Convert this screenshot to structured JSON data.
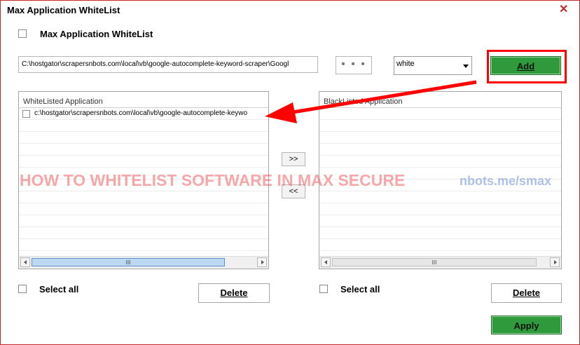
{
  "window": {
    "title": "Max Application WhiteList"
  },
  "top_option": {
    "label": "Max Application WhiteList"
  },
  "path_input": {
    "value": "C:\\hostgator\\scrapersnbots.com\\local\\vb\\google-autocomplete-keyword-scraper\\Googl"
  },
  "browse_button": {
    "label": "• • •"
  },
  "list_type_select": {
    "value": "white"
  },
  "add_button": {
    "label": "Add"
  },
  "whitelist_panel": {
    "header": "WhiteListed Application",
    "items": [
      "c:\\hostgator\\scrapersnbots.com\\local\\vb\\google-autocomplete-keywo"
    ]
  },
  "blacklist_panel": {
    "header": "BlackListed Application",
    "items": []
  },
  "move_right_button": {
    "label": ">>"
  },
  "move_left_button": {
    "label": "<<"
  },
  "left_controls": {
    "select_all": "Select all",
    "delete": "Delete"
  },
  "right_controls": {
    "select_all": "Select all",
    "delete": "Delete"
  },
  "apply_button": {
    "label": "Apply"
  },
  "watermark": {
    "text": "HOW TO WHITELIST SOFTWARE IN MAX SECURE",
    "url": "nbots.me/smax"
  },
  "scrollbar_thumb": {
    "glyph": "III"
  },
  "colors": {
    "accent_green": "#2e9a3c",
    "highlight_red": "#ff0000",
    "frame_red": "#c62828"
  },
  "icons": {
    "close": "close-icon",
    "dropdown": "chevron-down-icon"
  }
}
